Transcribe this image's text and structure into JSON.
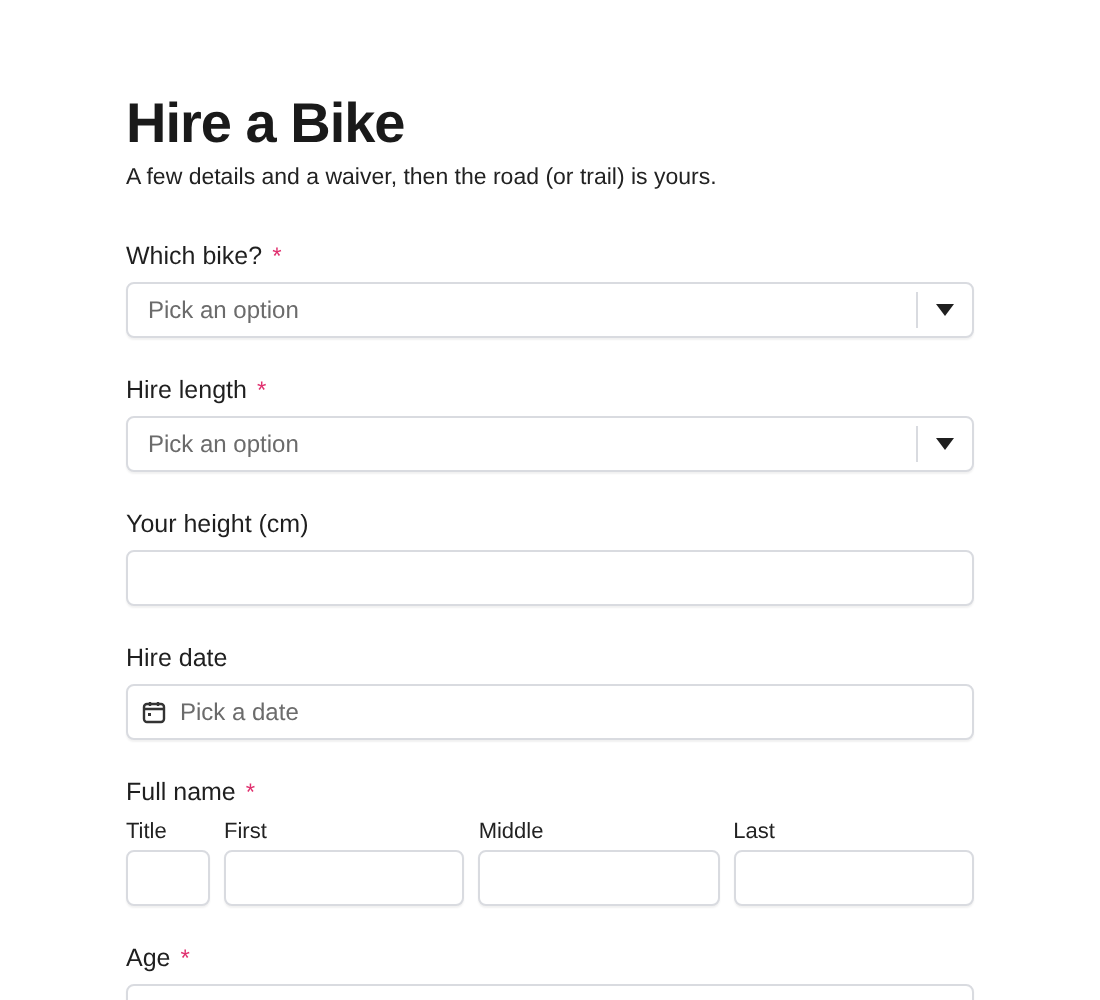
{
  "title": "Hire a Bike",
  "subtitle": "A few details and a waiver, then the road (or trail) is yours.",
  "fields": [
    {
      "kind": "select",
      "label": "Which bike?",
      "required_mark": "*",
      "placeholder": "Pick an option"
    },
    {
      "kind": "select",
      "label": "Hire length",
      "required_mark": "*",
      "placeholder": "Pick an option"
    },
    {
      "kind": "text",
      "label": "Your height (cm)"
    },
    {
      "kind": "date",
      "label": "Hire date",
      "placeholder": "Pick a date"
    },
    {
      "kind": "name",
      "label": "Full name",
      "required_mark": "*",
      "parts": [
        "Title",
        "First",
        "Middle",
        "Last"
      ]
    },
    {
      "kind": "text",
      "label": "Age",
      "required_mark": "*"
    }
  ]
}
